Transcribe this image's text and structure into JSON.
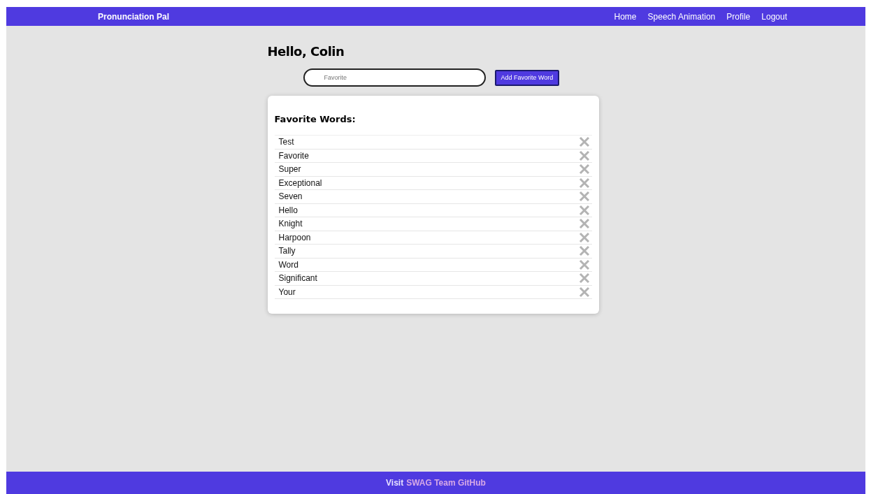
{
  "navbar": {
    "brand": "Pronunciation Pal",
    "links": [
      "Home",
      "Speech Animation",
      "Profile",
      "Logout"
    ]
  },
  "greeting": "Hello, Colin",
  "add_form": {
    "placeholder": "Favorite",
    "button": "Add Favorite Word"
  },
  "favorites": {
    "title": "Favorite Words:",
    "words": [
      "Test",
      "Favorite",
      "Super",
      "Exceptional",
      "Seven",
      "Hello",
      "Knight",
      "Harpoon",
      "Tally",
      "Word",
      "Significant",
      "Your"
    ]
  },
  "footer": {
    "text": "Visit",
    "link": "SWAG Team GitHub"
  }
}
